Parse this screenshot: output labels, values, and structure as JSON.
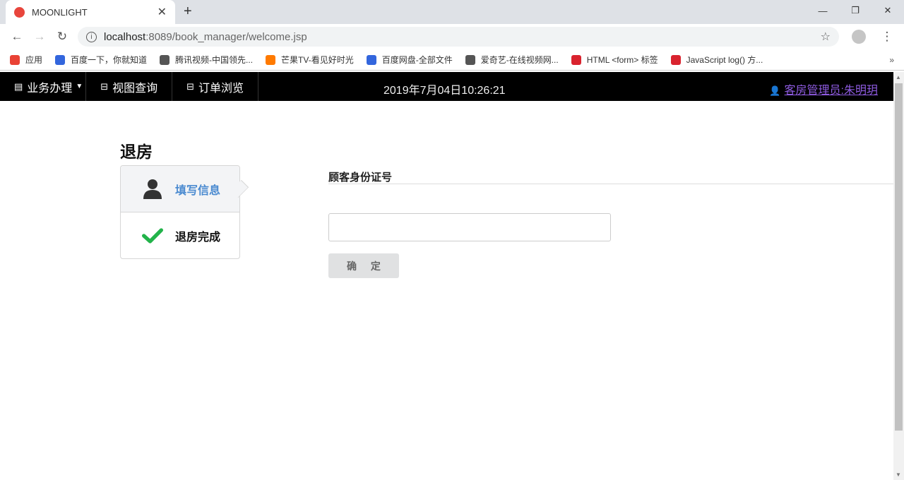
{
  "browser": {
    "tab_title": "MOONLIGHT",
    "url_host": "localhost",
    "url_rest": ":8089/book_manager/welcome.jsp",
    "bookmarks": [
      {
        "label": "应用",
        "color": "#e94235"
      },
      {
        "label": "百度一下，你就知道",
        "color": "#3366dd"
      },
      {
        "label": "腾讯视频-中国领先...",
        "color": "#555555"
      },
      {
        "label": "芒果TV-看见好时光",
        "color": "#ff7a00"
      },
      {
        "label": "百度网盘-全部文件",
        "color": "#3366dd"
      },
      {
        "label": "爱奇艺-在线视频网...",
        "color": "#555555"
      },
      {
        "label": "HTML <form> 标签",
        "color": "#d9232e"
      },
      {
        "label": "JavaScript log() 方...",
        "color": "#d9232e"
      }
    ]
  },
  "navbar": {
    "menus": [
      "业务办理",
      "视图查询",
      "订单浏览"
    ],
    "datetime": "2019年7月04日10:26:21",
    "user": "客房管理员:朱明玥"
  },
  "page": {
    "title": "退房",
    "steps": [
      {
        "label": "填写信息",
        "active": true
      },
      {
        "label": "退房完成",
        "active": false
      }
    ],
    "field_label": "顾客身份证号",
    "input_value": "",
    "submit_label": "确 定"
  }
}
